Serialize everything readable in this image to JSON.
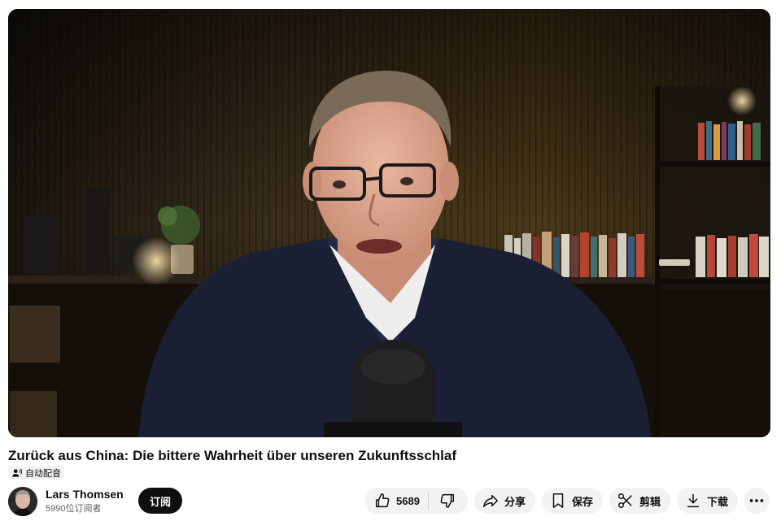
{
  "video": {
    "title": "Zurück aus China: Die bittere Wahrheit über unseren Zukunftsschlaf",
    "dub_badge": "自动配音"
  },
  "channel": {
    "name": "Lars Thomsen",
    "subscribers": "5990位订阅者",
    "subscribe_label": "订阅"
  },
  "actions": {
    "like_count": "5689",
    "share_label": "分享",
    "save_label": "保存",
    "clip_label": "剪辑",
    "download_label": "下载"
  },
  "icons": {
    "dub": "dub-icon",
    "like": "thumbs-up-icon",
    "dislike": "thumbs-down-icon",
    "share": "share-arrow-icon",
    "save": "bookmark-icon",
    "clip": "scissors-icon",
    "download": "download-icon",
    "more": "more-horizontal-icon"
  },
  "colors": {
    "subscribe_bg": "#0f0f0f",
    "pill_bg": "#f2f2f2",
    "secondary_text": "#606060"
  }
}
